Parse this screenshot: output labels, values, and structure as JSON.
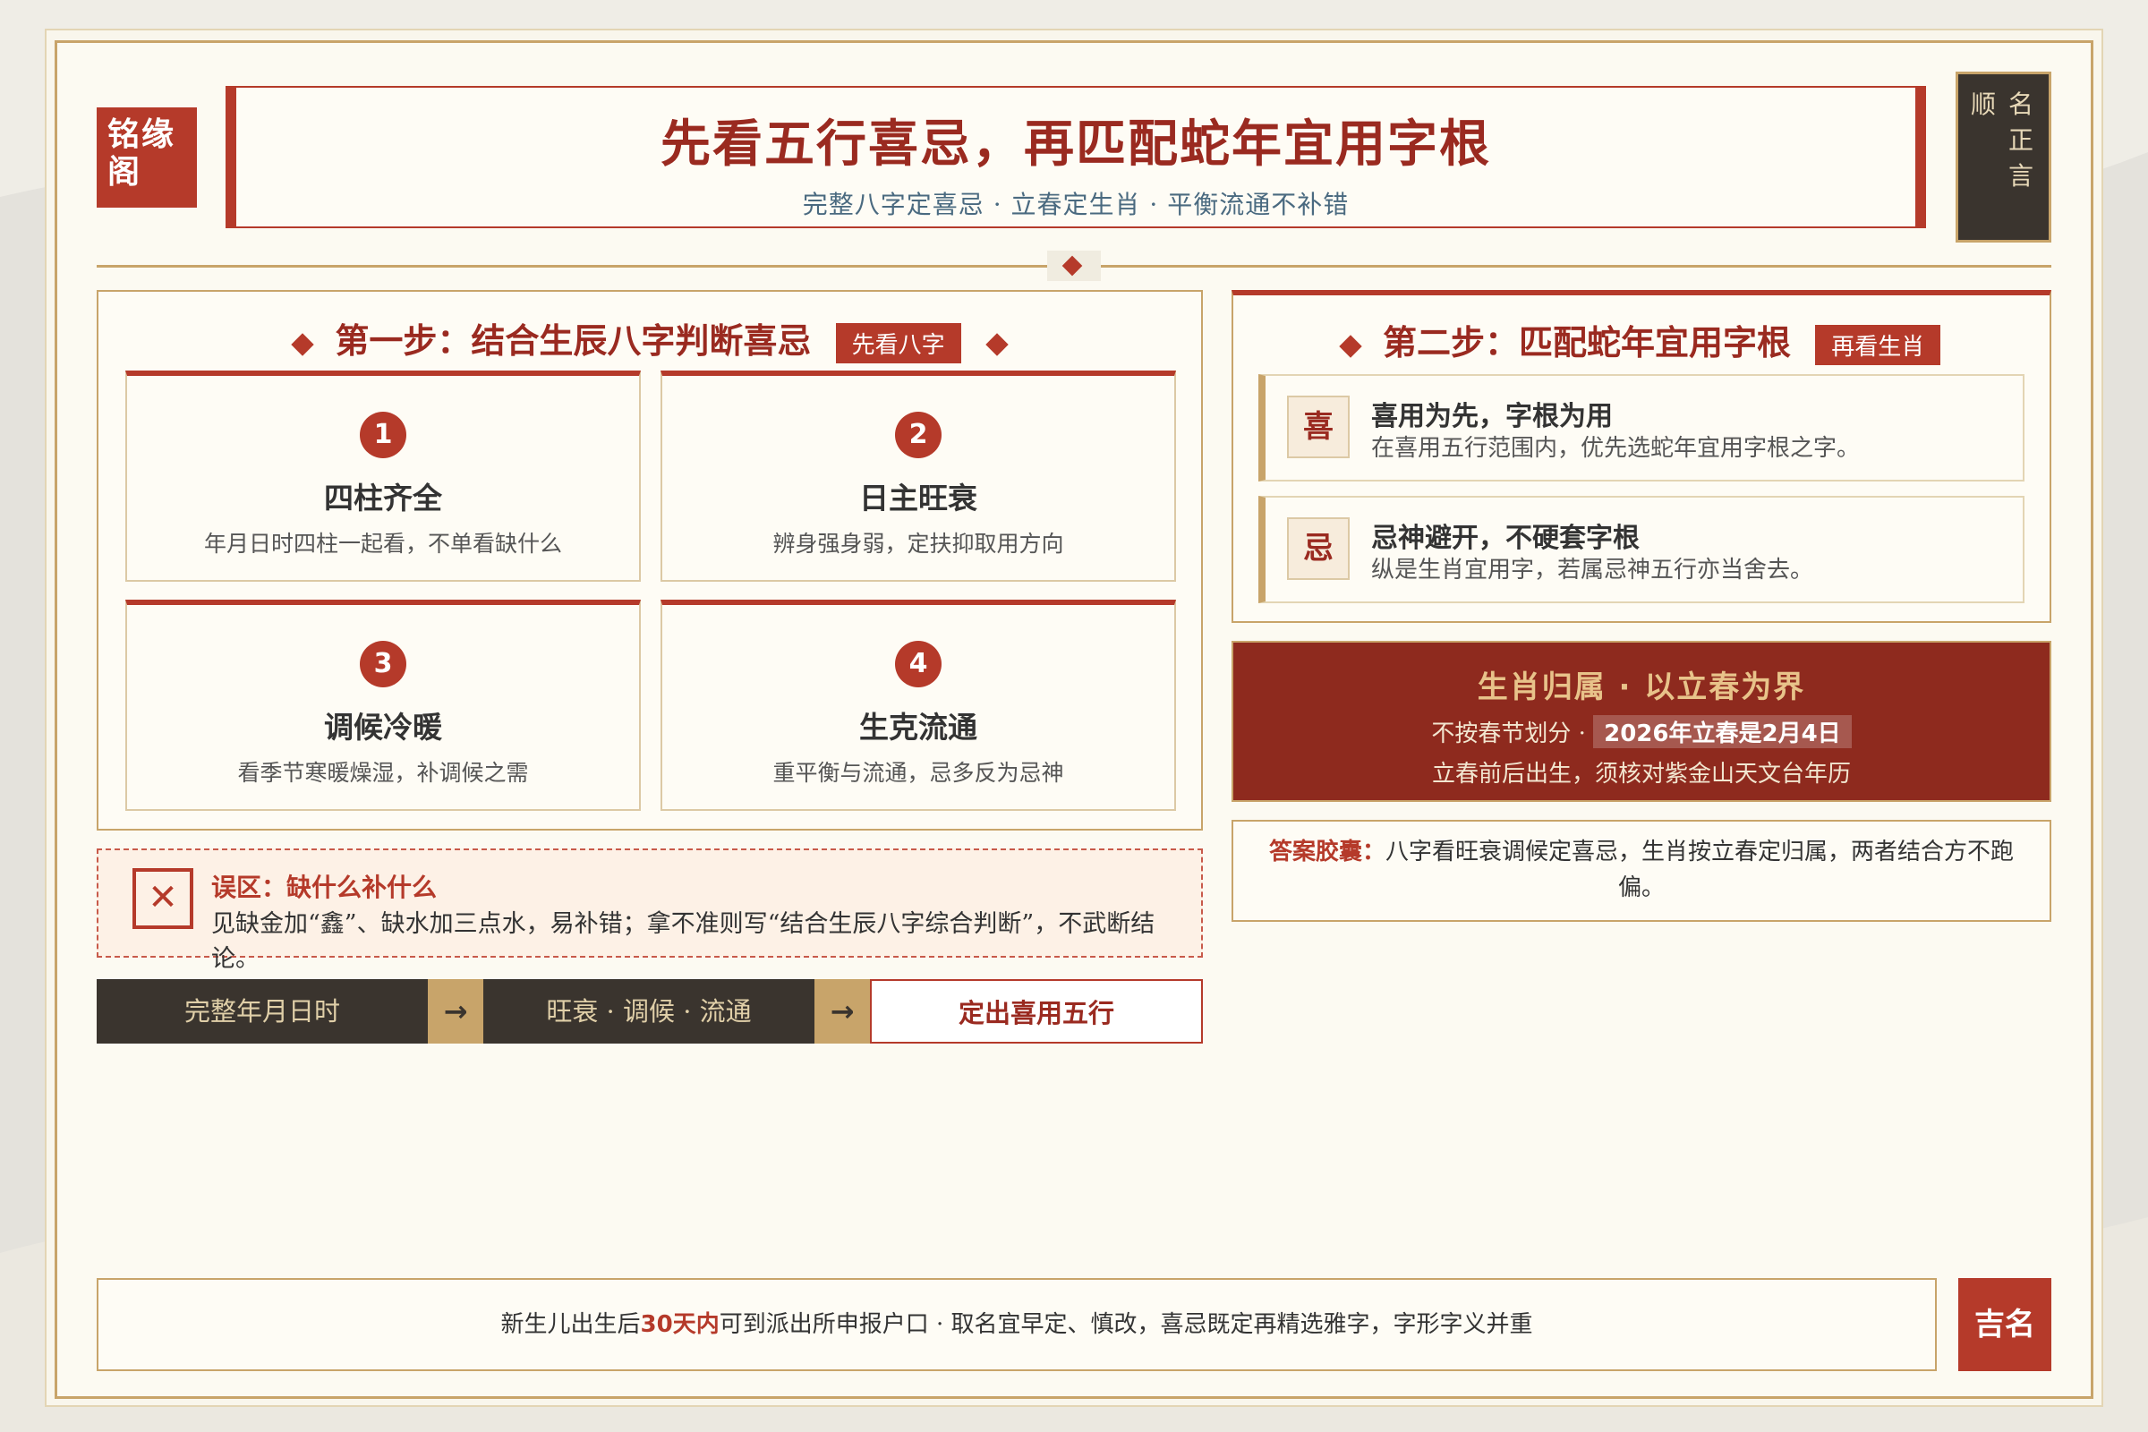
{
  "brand": {
    "logo_text": "铭缘阁"
  },
  "header": {
    "title": "先看五行喜忌，再匹配蛇年宜用字根",
    "subtitle": "完整八字定喜忌 · 立春定生肖 · 平衡流通不补错",
    "seal_col1": [
      "名",
      "正",
      "言"
    ],
    "seal_col2": [
      "顺"
    ]
  },
  "step1": {
    "heading": "第一步：结合生辰八字判断喜忌",
    "tag": "先看八字",
    "cards": [
      {
        "num": "1",
        "title": "四柱齐全",
        "desc": "年月日时四柱一起看，不单看缺什么"
      },
      {
        "num": "2",
        "title": "日主旺衰",
        "desc": "辨身强身弱，定扶抑取用方向"
      },
      {
        "num": "3",
        "title": "调候冷暖",
        "desc": "看季节寒暖燥湿，补调候之需"
      },
      {
        "num": "4",
        "title": "生克流通",
        "desc": "重平衡与流通，忌多反为忌神"
      }
    ]
  },
  "mistake": {
    "icon": "close-icon",
    "title": "误区：缺什么补什么",
    "desc": "见缺金加“鑫”、缺水加三点水，易补错；拿不准则写“结合生辰八字综合判断”，不武断结论。"
  },
  "flow": {
    "steps": [
      "完整年月日时",
      "旺衰 · 调候 · 流通",
      "定出喜用五行"
    ],
    "arrow": "→"
  },
  "step2": {
    "heading": "第二步：匹配蛇年宜用字根",
    "tag": "再看生肖",
    "rules": [
      {
        "char": "喜",
        "title": "喜用为先，字根为用",
        "desc": "在喜用五行范围内，优先选蛇年宜用字根之字。"
      },
      {
        "char": "忌",
        "title": "忌神避开，不硬套字根",
        "desc": "纵是生肖宜用字，若属忌神五行亦当舍去。"
      }
    ]
  },
  "zodiac": {
    "title": "生肖归属 · 以立春为界",
    "line1_prefix": "不按春节划分 · ",
    "line1_highlight": "2026年立春是2月4日",
    "line2": "立春前后出生，须核对紫金山天文台年历"
  },
  "answer": {
    "label": "答案胶囊：",
    "text": "八字看旺衰调候定喜忌，生肖按立春定归属，两者结合方不跑偏。"
  },
  "footer": {
    "prefix": "新生儿出生后",
    "highlight": "30天内",
    "suffix": "可到派出所申报户口 · 取名宜早定、慎改，喜忌既定再精选雅字，字形字义并重",
    "seal": "吉名"
  },
  "colors": {
    "primary_red": "#b53a2a",
    "dark_red": "#8e2a1e",
    "gold": "#c8a46a",
    "dark": "#3a342e",
    "paper": "#fcfaf2"
  }
}
